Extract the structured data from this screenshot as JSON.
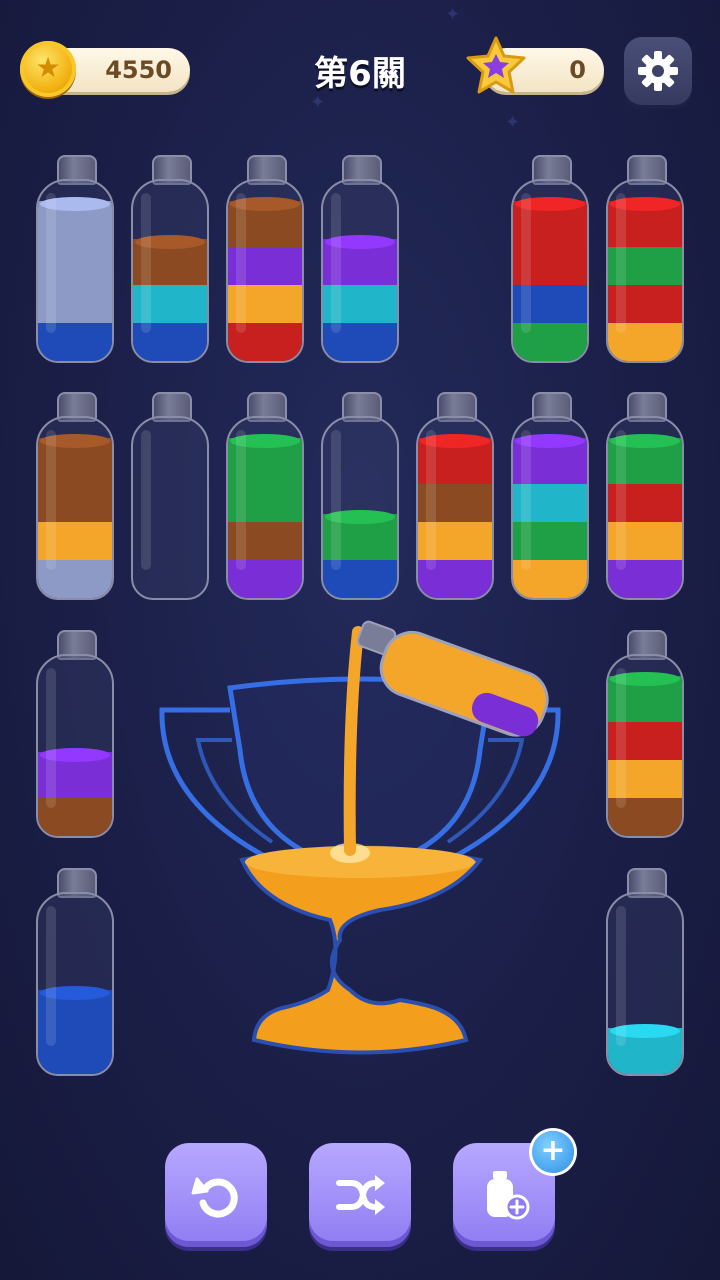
{
  "hud": {
    "coins": "4550",
    "level_title": "第6關",
    "stars": "0",
    "coin_icon": "coin-icon",
    "star_icon": "star-icon",
    "settings_icon": "gear-icon"
  },
  "colors": {
    "blue": "#1f4bb8",
    "cyan": "#21b5c9",
    "brown": "#8b4a22",
    "purple": "#7a2fd6",
    "orange": "#f4a62a",
    "red": "#c7201f",
    "green": "#1fa046",
    "pale": "#8e9ac6"
  },
  "bottles": [
    {
      "id": "b1",
      "layers": [
        "blue",
        "pale",
        "pale",
        "pale"
      ]
    },
    {
      "id": "b2",
      "layers": [
        "blue",
        "cyan",
        "brown"
      ]
    },
    {
      "id": "b3",
      "layers": [
        "red",
        "orange",
        "purple",
        "brown"
      ]
    },
    {
      "id": "b4",
      "layers": [
        "blue",
        "cyan",
        "purple"
      ]
    },
    {
      "id": "b5",
      "layers": [
        "green",
        "blue",
        "red",
        "red"
      ]
    },
    {
      "id": "b6",
      "layers": [
        "orange",
        "red",
        "green",
        "red"
      ]
    },
    {
      "id": "b7",
      "layers": [
        "pale",
        "orange",
        "brown",
        "brown"
      ]
    },
    {
      "id": "b8",
      "layers": []
    },
    {
      "id": "b9",
      "layers": [
        "purple",
        "brown",
        "green",
        "green"
      ]
    },
    {
      "id": "b10",
      "layers": [
        "blue",
        "green"
      ]
    },
    {
      "id": "b11",
      "layers": [
        "purple",
        "orange",
        "brown",
        "red"
      ]
    },
    {
      "id": "b12",
      "layers": [
        "orange",
        "green",
        "cyan",
        "purple"
      ]
    },
    {
      "id": "b13",
      "layers": [
        "purple",
        "orange",
        "red",
        "green"
      ]
    },
    {
      "id": "b14",
      "layers": [
        "brown",
        "purple"
      ]
    },
    {
      "id": "b15",
      "layers": [
        "brown",
        "orange",
        "red",
        "green"
      ]
    },
    {
      "id": "b16",
      "layers": [
        "blue",
        "blue"
      ]
    },
    {
      "id": "b17",
      "layers": [
        "cyan"
      ]
    }
  ],
  "pouring_bottle": {
    "layers": [
      "purple",
      "orange",
      "orange"
    ]
  },
  "tools": [
    {
      "name": "undo-button",
      "icon": "undo-icon"
    },
    {
      "name": "shuffle-button",
      "icon": "shuffle-icon"
    },
    {
      "name": "add-bottle-button",
      "icon": "add-bottle-icon"
    }
  ]
}
